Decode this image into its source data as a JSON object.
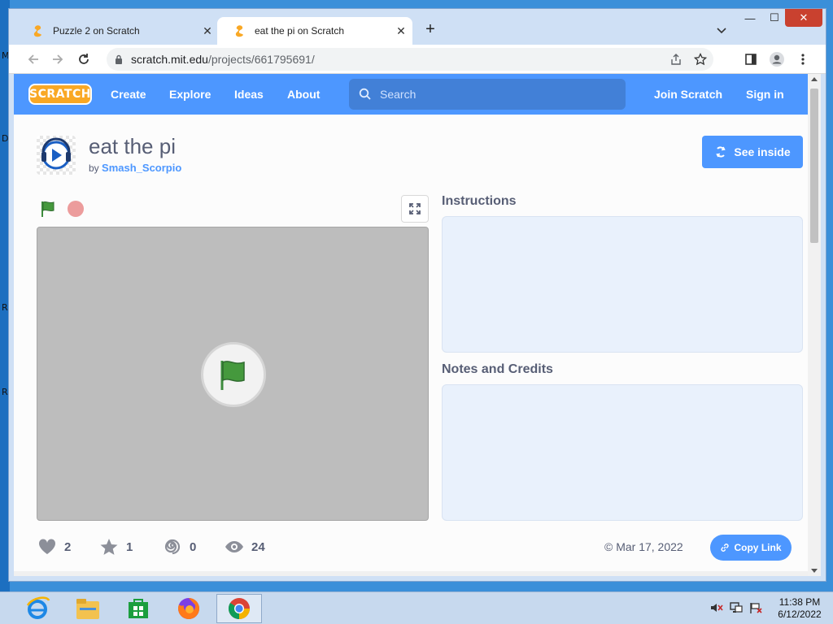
{
  "desktop": {
    "side_letters": [
      "M",
      "D",
      "R",
      "R"
    ]
  },
  "browser": {
    "tabs": [
      {
        "title": "Puzzle 2 on Scratch",
        "active": false
      },
      {
        "title": "eat the pi on Scratch",
        "active": true
      }
    ],
    "new_tab": "+",
    "close_glyph": "✕",
    "window_controls": {
      "minimize": "—",
      "maximize": "☐",
      "close": "✕"
    },
    "url": {
      "host": "scratch.mit.edu",
      "path": "/projects/661795691/"
    }
  },
  "scratch_nav": {
    "logo": "SCRATCH",
    "links": [
      "Create",
      "Explore",
      "Ideas",
      "About"
    ],
    "search_placeholder": "Search",
    "join": "Join Scratch",
    "sign_in": "Sign in"
  },
  "project": {
    "title": "eat the pi",
    "by_prefix": "by",
    "author": "Smash_Scorpio",
    "see_inside": "See inside",
    "instructions_title": "Instructions",
    "notes_title": "Notes and Credits",
    "stats": {
      "loves": "2",
      "favorites": "1",
      "remixes": "0",
      "views": "24"
    },
    "date": "© Mar 17, 2022",
    "copy_link": "Copy Link"
  },
  "taskbar": {
    "clock_time": "11:38 PM",
    "clock_date": "6/12/2022",
    "apps": [
      "internet-explorer",
      "file-explorer",
      "store",
      "firefox",
      "chrome"
    ]
  },
  "colors": {
    "scratch_blue": "#4d97ff",
    "nav_bg": "#4d97ff",
    "stage_bg": "#bdbdbd",
    "note_bg": "#e9f1fc"
  }
}
